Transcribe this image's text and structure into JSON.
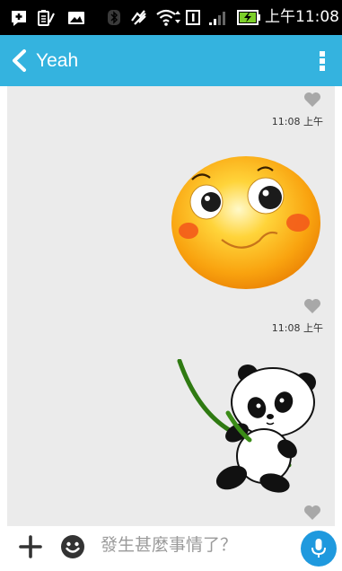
{
  "status_bar": {
    "clock": "上午11:08"
  },
  "app_bar": {
    "title": "Yeah"
  },
  "messages": [
    {
      "type": "sticker",
      "sticker": "smiling-sun-face",
      "time": "11:08 上午",
      "liked": false
    },
    {
      "type": "sticker",
      "sticker": "panda-with-bamboo",
      "time": "11:08 上午",
      "liked": false
    }
  ],
  "input": {
    "placeholder": "發生甚麼事情了？"
  },
  "colors": {
    "status_bar": "#000000",
    "app_bar": "#34b3df",
    "chat_background": "#ebebeb",
    "mic_button": "#1f99de",
    "like_icon": "#a8a8a8"
  }
}
